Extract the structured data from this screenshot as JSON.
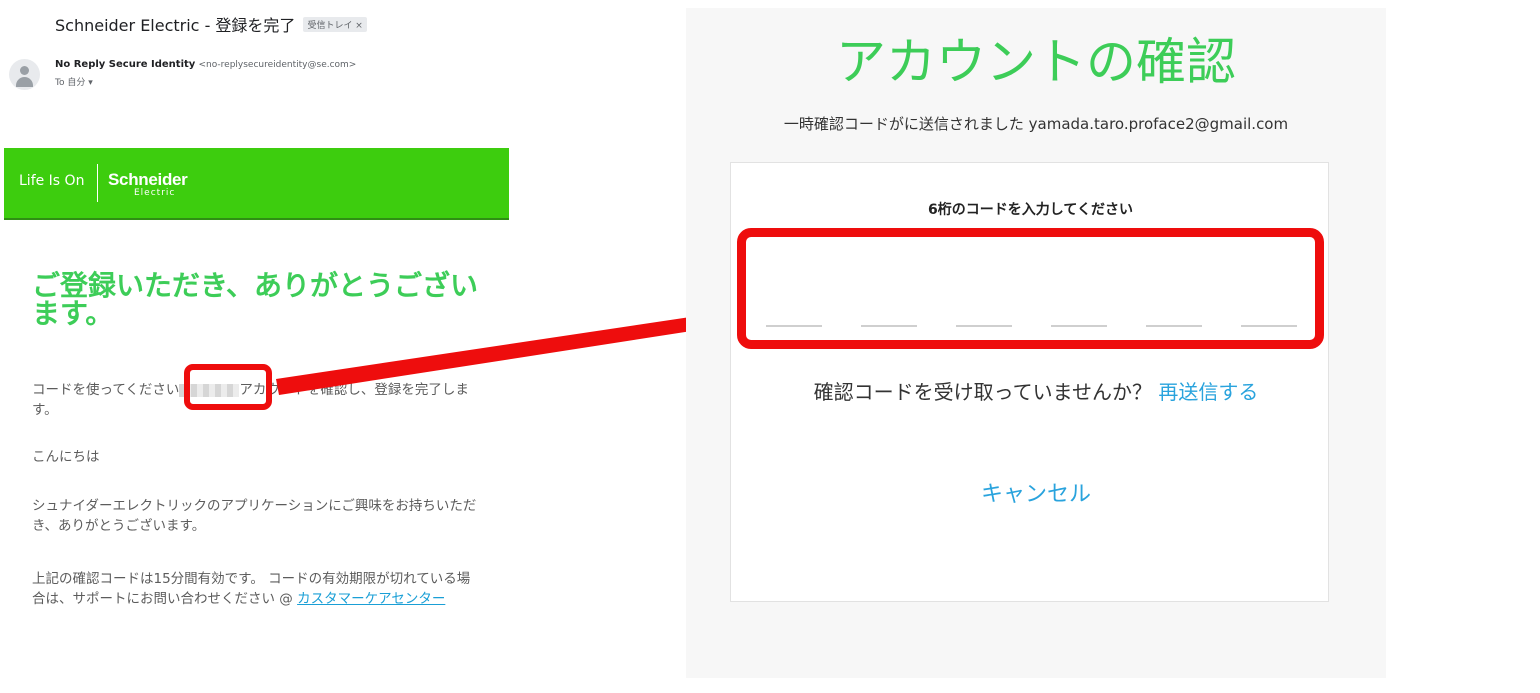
{
  "email": {
    "subject": "Schneider Electric - 登録を完了",
    "label": "受信トレイ ×",
    "sender_name": "No Reply Secure Identity",
    "sender_address": "<no-replysecureidentity@se.com>",
    "recipient": "To 自分 ▾",
    "banner": {
      "tagline": "Life Is On",
      "brand": "Schneider",
      "brand_sub": "Electric",
      "color": "#3dcd0e"
    },
    "title": "ご登録いただき、ありがとうございます。",
    "p1_before": "コードを使ってください",
    "p1_after": "アカウントを確認し、登録を完了します。",
    "p2": "こんにちは",
    "p3": "シュナイダーエレクトリックのアプリケーションにご興味をお持ちいただき、ありがとうございます。",
    "p4": "上記の確認コードは15分間有効です。 コードの有効期限が切れている場合は、サポートにお問い合わせください @ ",
    "p4_link": "カスタマーケアセンター"
  },
  "verify": {
    "title": "アカウントの確認",
    "sent_message": "一時確認コードがに送信されました yamada.taro.proface2@gmail.com",
    "code_label": "6桁のコードを入力してください",
    "digit_count": 6,
    "resend_prompt": "確認コードを受け取っていませんか？ ",
    "resend_link": "再送信する",
    "cancel": "キャンセル"
  },
  "annotation": {
    "highlight_color": "#ee0d0d"
  }
}
